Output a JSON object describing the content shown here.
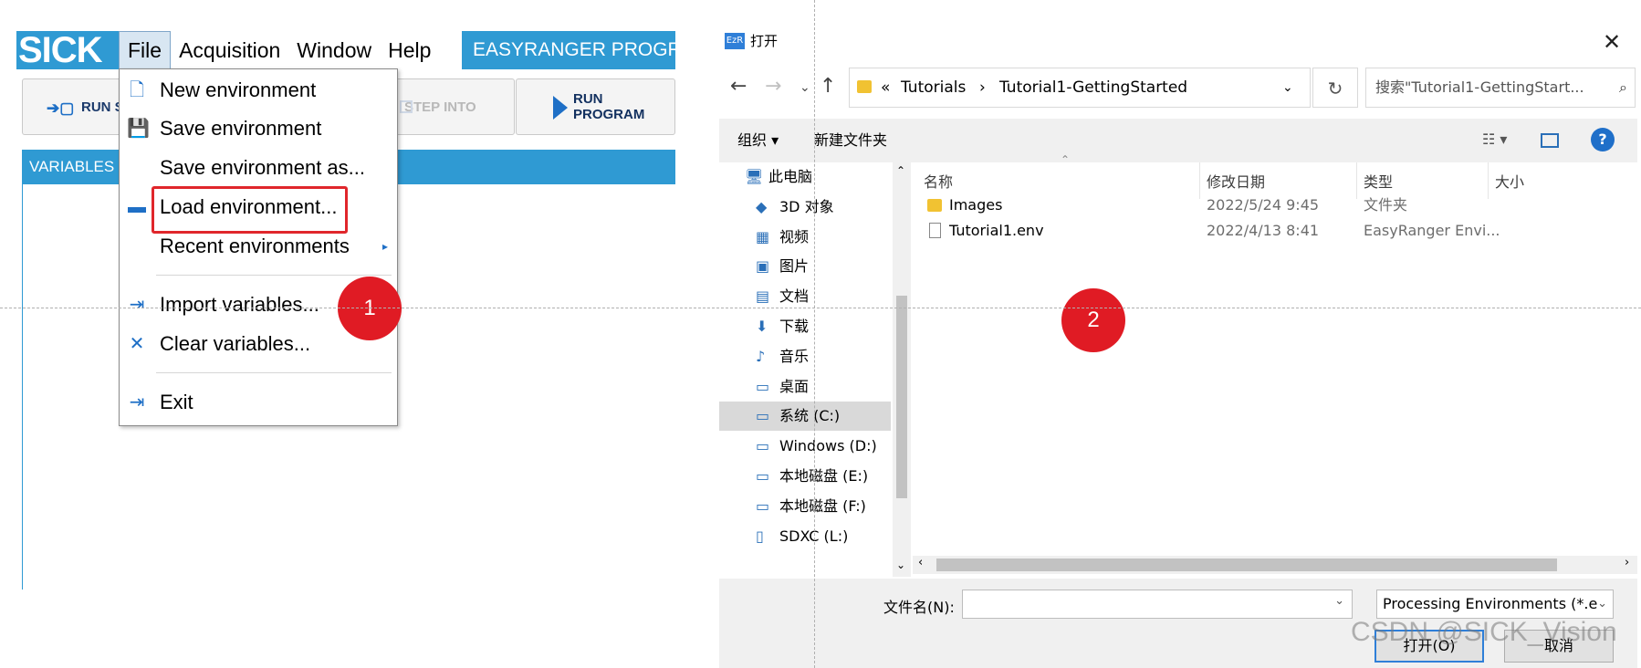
{
  "app": {
    "logo": "SICK",
    "menu": [
      "File",
      "Acquisition",
      "Window",
      "Help"
    ],
    "title": "EASYRANGER PROGRAM",
    "toolbar": {
      "run_step": "RUN S",
      "step_into": "STEP INTO",
      "run_program": "RUN PROGRAM"
    },
    "variables_header": "VARIABLES",
    "file_menu": {
      "new_env": "New environment",
      "save_env": "Save environment",
      "save_env_as": "Save environment as...",
      "load_env": "Load environment...",
      "recent_envs": "Recent environments",
      "import_vars": "Import variables...",
      "clear_vars": "Clear variables...",
      "exit": "Exit"
    },
    "badge1": "1"
  },
  "dialog": {
    "app_icon": "EzR",
    "title": "打开",
    "path": {
      "prefix": "«",
      "segments": [
        "Tutorials",
        "Tutorial1-GettingStarted"
      ]
    },
    "search_placeholder": "搜索\"Tutorial1-GettingStart...",
    "organize": "组织 ▾",
    "new_folder": "新建文件夹",
    "columns": {
      "name": "名称",
      "date": "修改日期",
      "type": "类型",
      "size": "大小"
    },
    "files": [
      {
        "name": "Images",
        "date": "2022/5/24 9:45",
        "type": "文件夹",
        "icon": "folder-icon"
      },
      {
        "name": "Tutorial1.env",
        "date": "2022/4/13 8:41",
        "type": "EasyRanger Envi...",
        "icon": "file-icon"
      }
    ],
    "nav": [
      {
        "label": "此电脑",
        "icon": "computer-icon"
      },
      {
        "label": "3D 对象",
        "icon": "3d-objects-icon"
      },
      {
        "label": "视频",
        "icon": "video-icon"
      },
      {
        "label": "图片",
        "icon": "pictures-icon"
      },
      {
        "label": "文档",
        "icon": "documents-icon"
      },
      {
        "label": "下载",
        "icon": "downloads-icon"
      },
      {
        "label": "音乐",
        "icon": "music-icon"
      },
      {
        "label": "桌面",
        "icon": "desktop-icon"
      },
      {
        "label": "系统 (C:)",
        "icon": "drive-c-icon",
        "selected": true
      },
      {
        "label": "Windows (D:)",
        "icon": "drive-icon"
      },
      {
        "label": "本地磁盘 (E:)",
        "icon": "drive-icon"
      },
      {
        "label": "本地磁盘 (F:)",
        "icon": "drive-icon"
      },
      {
        "label": "SDXC (L:)",
        "icon": "sd-card-icon"
      }
    ],
    "filename_label": "文件名(N):",
    "filename_value": "",
    "filetype": "Processing Environments (*.e",
    "open_button": "打开(O)",
    "cancel_button": "取消",
    "badge2": "2"
  },
  "watermark": "CSDN @SICK_Vision",
  "colors": {
    "sick_blue": "#2f9ad3",
    "badge_red": "#e01b24",
    "highlight_red": "#e0262b"
  }
}
